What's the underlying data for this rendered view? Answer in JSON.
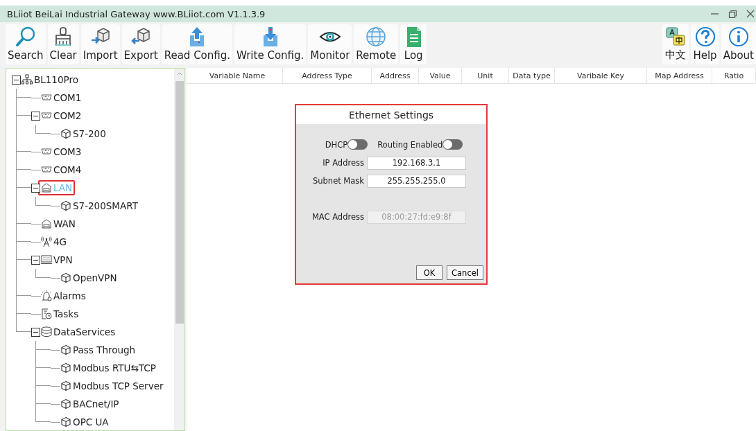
{
  "window": {
    "title": "BLiiot BeiLai Industrial Gateway www.BLiiot.com V1.1.3.9"
  },
  "toolbar": {
    "left": [
      {
        "label": "Search",
        "kind": "search"
      },
      {
        "label": "Clear",
        "kind": "clear"
      },
      {
        "label": "Import",
        "kind": "import"
      },
      {
        "label": "Export",
        "kind": "export"
      },
      {
        "label": "Read Config.",
        "kind": "read"
      },
      {
        "label": "Write Config.",
        "kind": "write"
      },
      {
        "label": "Monitor",
        "kind": "monitor"
      },
      {
        "label": "Remote",
        "kind": "remote"
      },
      {
        "label": "Log",
        "kind": "log"
      }
    ],
    "right": [
      {
        "label": "中文",
        "kind": "language"
      },
      {
        "label": "Help",
        "kind": "help"
      },
      {
        "label": "About",
        "kind": "about"
      }
    ]
  },
  "tree": {
    "items": [
      {
        "label": "BL110Pro",
        "kind": "network",
        "expanded": true,
        "selected": false,
        "annotated": false,
        "children": [
          {
            "label": "COM1",
            "kind": "serial",
            "selected": false,
            "annotated": false
          },
          {
            "label": "COM2",
            "kind": "serial",
            "expanded": true,
            "selected": false,
            "annotated": false,
            "children": [
              {
                "label": "S7-200",
                "kind": "device",
                "selected": false,
                "annotated": false
              }
            ]
          },
          {
            "label": "COM3",
            "kind": "serial",
            "selected": false,
            "annotated": false
          },
          {
            "label": "COM4",
            "kind": "serial",
            "selected": false,
            "annotated": false
          },
          {
            "label": "LAN",
            "kind": "lan",
            "expanded": true,
            "selected": true,
            "annotated": true,
            "children": [
              {
                "label": "S7-200SMART",
                "kind": "device",
                "selected": false,
                "annotated": false
              }
            ]
          },
          {
            "label": "WAN",
            "kind": "lan",
            "selected": false,
            "annotated": false
          },
          {
            "label": "4G",
            "kind": "antenna",
            "selected": false,
            "annotated": false
          },
          {
            "label": "VPN",
            "kind": "vpn",
            "expanded": true,
            "selected": false,
            "annotated": false,
            "children": [
              {
                "label": "OpenVPN",
                "kind": "device",
                "selected": false,
                "annotated": false
              }
            ]
          },
          {
            "label": "Alarms",
            "kind": "alarm",
            "selected": false,
            "annotated": false
          },
          {
            "label": "Tasks",
            "kind": "task",
            "selected": false,
            "annotated": false
          },
          {
            "label": "DataServices",
            "kind": "database",
            "expanded": true,
            "selected": false,
            "annotated": false,
            "children": [
              {
                "label": "Pass Through",
                "kind": "device",
                "selected": false,
                "annotated": false
              },
              {
                "label": "Modbus RTU⇆TCP",
                "kind": "device",
                "selected": false,
                "annotated": false
              },
              {
                "label": "Modbus TCP Server",
                "kind": "device",
                "selected": false,
                "annotated": false
              },
              {
                "label": "BACnet/IP",
                "kind": "device",
                "selected": false,
                "annotated": false
              },
              {
                "label": "OPC UA",
                "kind": "device",
                "selected": false,
                "annotated": false
              }
            ]
          }
        ]
      }
    ]
  },
  "table": {
    "columns": [
      "Variable Name",
      "Address Type",
      "Address",
      "Value",
      "Unit",
      "Data type",
      "Varibale Key",
      "Map Address",
      "Ratio"
    ]
  },
  "dialog": {
    "title": "Ethernet Settings",
    "annotated": true,
    "toggles": [
      {
        "label": "DHCP",
        "on": false
      },
      {
        "label": "Routing Enabled",
        "on": false
      }
    ],
    "fields": [
      {
        "label": "IP Address",
        "value": "192.168.3.1",
        "disabled": false
      },
      {
        "label": "Subnet Mask",
        "value": "255.255.255.0",
        "disabled": false
      },
      {
        "label": "MAC Address",
        "value": "08:00:27:fd:e9:8f",
        "disabled": true
      }
    ],
    "buttons": [
      "OK",
      "Cancel"
    ]
  }
}
